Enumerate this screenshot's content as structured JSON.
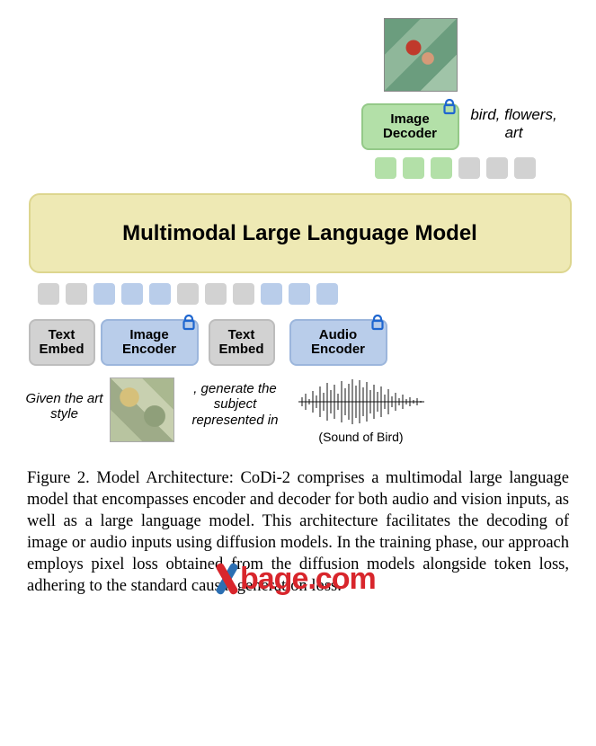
{
  "diagram": {
    "decoder_label": "Image\nDecoder",
    "decoder_output_text": "bird, flowers, art",
    "mllm_label": "Multimodal Large Language Model",
    "encoders": {
      "text_embed": "Text\nEmbed",
      "image_encoder": "Image\nEncoder",
      "audio_encoder": "Audio\nEncoder"
    },
    "bottom": {
      "prompt1": "Given the art style",
      "prompt2": ", generate the subject represented in",
      "audio_caption": "(Sound of Bird)"
    },
    "top_tokens": [
      "green",
      "green",
      "green",
      "grey",
      "grey",
      "grey"
    ],
    "bottom_tokens": [
      "grey",
      "grey",
      "blue",
      "blue",
      "blue",
      "grey",
      "grey",
      "grey",
      "blue",
      "blue",
      "blue"
    ]
  },
  "caption": {
    "text": "Figure 2. Model Architecture: CoDi-2 comprises a multimodal large language model that encompasses encoder and decoder for both audio and vision inputs, as well as a large language model. This architecture facilitates the decoding of image or audio inputs using diffusion models. In the training phase, our approach employs pixel loss obtained from the diffusion models alongside token loss, adhering to the standard causal generation loss."
  },
  "watermark": "bage.com"
}
